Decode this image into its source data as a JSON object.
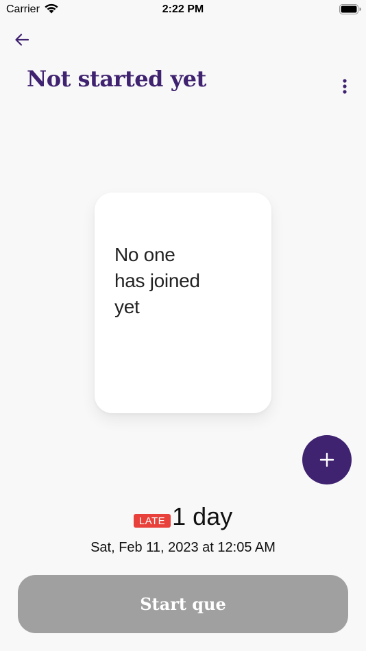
{
  "status_bar": {
    "carrier": "Carrier",
    "time": "2:22 PM",
    "wifi_icon": "wifi-icon",
    "battery_icon": "battery-icon"
  },
  "header": {
    "back_icon": "arrow-left-icon",
    "title": "Not started yet",
    "more_icon": "more-vertical-icon"
  },
  "card": {
    "empty_text": "No one\nhas joined\nyet"
  },
  "fab": {
    "icon": "plus-icon"
  },
  "deadline": {
    "badge": "LATE",
    "duration": "1 day",
    "date": "Sat, Feb 11, 2023 at 12:05 AM"
  },
  "actions": {
    "start_label": "Start que"
  },
  "colors": {
    "brand": "#3f2270",
    "late": "#e8403a",
    "disabled_button": "#a0a0a0",
    "background": "#f8f8f8"
  }
}
